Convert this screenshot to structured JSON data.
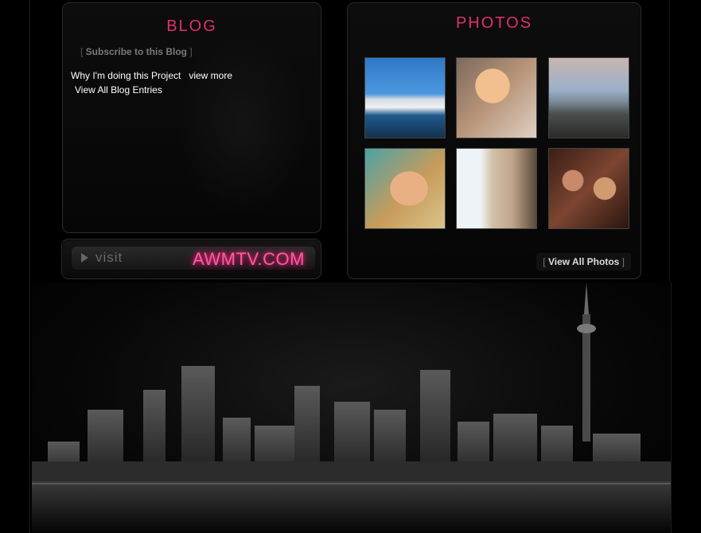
{
  "blog": {
    "title": "BLOG",
    "subscribe_open": "[ ",
    "subscribe_label": "Subscribe to this Blog",
    "subscribe_close": " ]",
    "entry_title": "Why I'm doing this Project",
    "entry_more": "view more",
    "all_entries": "View All Blog Entries"
  },
  "visit": {
    "label": "visit",
    "site": "AWMTV.COM"
  },
  "photos": {
    "title": "PHOTOS",
    "view_all_open": "[ ",
    "view_all_label": "View All Photos",
    "view_all_close": " ]",
    "thumbnails": [
      "photo-yacht",
      "photo-sunglasses-woman",
      "photo-beach",
      "photo-woman-face",
      "photo-woman-wall",
      "photo-group-women"
    ]
  },
  "colors": {
    "accent": "#e0306f",
    "neon": "#ff5aa0"
  }
}
